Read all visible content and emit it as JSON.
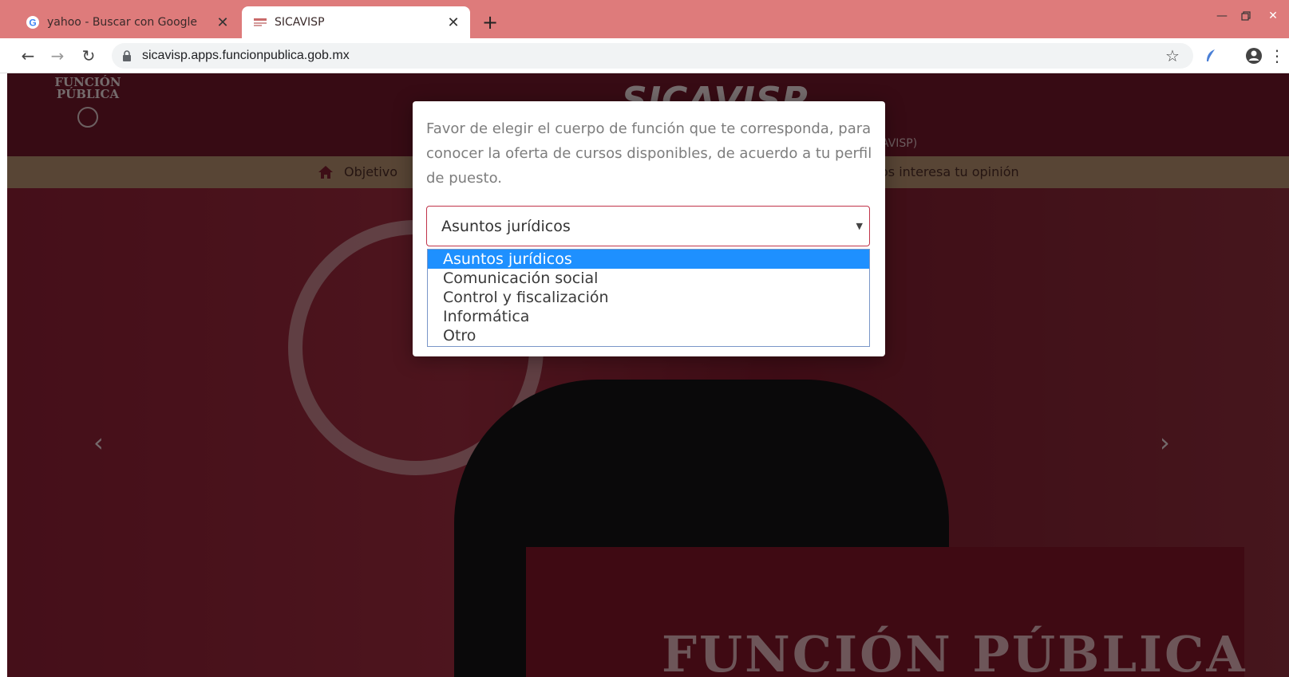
{
  "browser": {
    "tabs": [
      {
        "title": "yahoo - Buscar con Google",
        "active": false
      },
      {
        "title": "SICAVISP",
        "active": true
      }
    ],
    "new_tab_label": "+",
    "url": "sicavisp.apps.funcionpublica.gob.mx"
  },
  "site": {
    "logo_line1": "FUNCIÓN",
    "logo_line2": "PÚBLICA",
    "brand": "SICAVISP",
    "brand_subtitle": "AVISP)",
    "menu": {
      "item_left": "Objetivo",
      "item_right": "os interesa tu opinión"
    },
    "podium_text": "FUNCIÓN PÚBLICA"
  },
  "modal": {
    "instruction": "Favor de elegir el cuerpo de función que te corresponda, para conocer la oferta de cursos disponibles, de acuerdo a tu perfil de puesto.",
    "select": {
      "selected_value": "Asuntos jurídicos",
      "options": [
        "Asuntos jurídicos",
        "Comunicación social",
        "Control y fiscalización",
        "Informática",
        "Otro"
      ],
      "highlighted_index": 0
    }
  },
  "colors": {
    "tabbar": "#de7b7b",
    "header": "#6f1628",
    "menu_bar": "#b08a6a",
    "select_border": "#c0344a",
    "highlight": "#1e90ff"
  }
}
